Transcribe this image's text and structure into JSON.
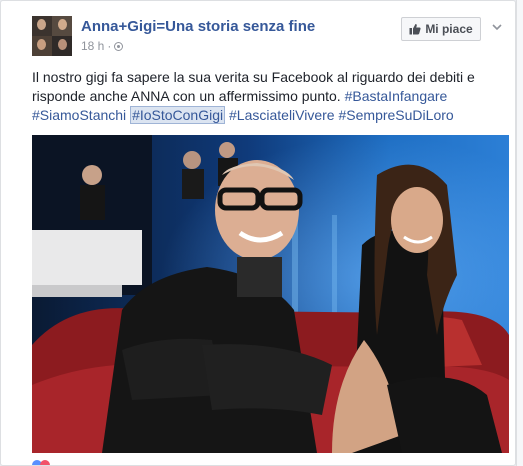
{
  "post": {
    "page_name": "Anna+Gigi=Una storia senza fine",
    "timestamp": "18 h",
    "separator": "·",
    "like_button_label": "Mi piace",
    "text_line1": "Il nostro gigi fa sapere la sua verita su Facebook al riguardo dei debiti e",
    "text_line2_pre": "risponde anche ANNA con un affermissimo punto. ",
    "hashtags": [
      "#BastaInfangare",
      "#SiamoStanchi",
      "#IoStoConGigi",
      "#LasciateliVivere",
      "#SempreSuDiLoro"
    ]
  },
  "colors": {
    "link": "#365899",
    "text": "#1d2129",
    "meta": "#90949c",
    "card_bg": "#ffffff",
    "page_bg": "#e9ebee"
  },
  "icons": {
    "thumb": "thumbs-up-icon",
    "chevron": "chevron-down-icon",
    "privacy": "globe-icon"
  }
}
